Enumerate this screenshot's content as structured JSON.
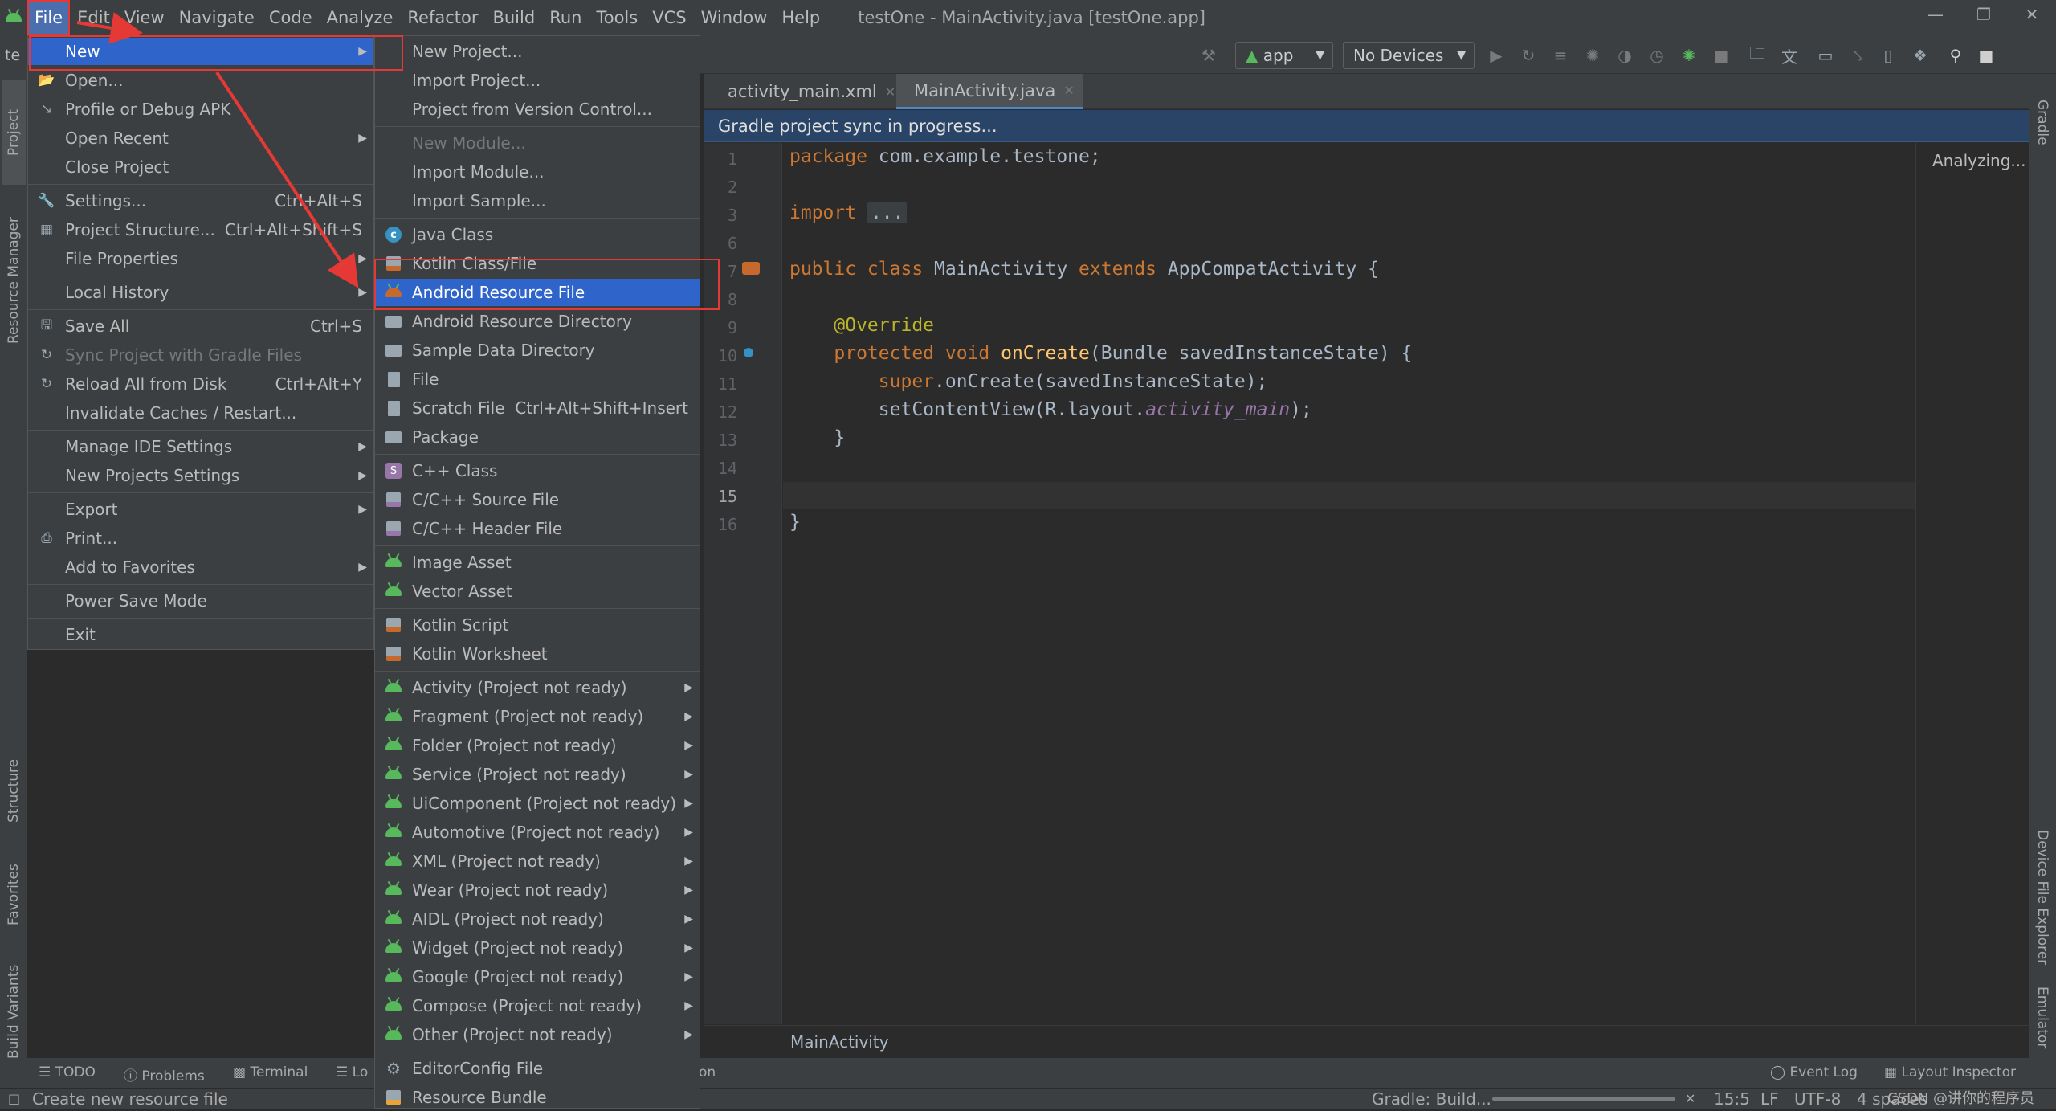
{
  "app": {
    "window_title": "testOne - MainActivity.java [testOne.app]",
    "project_stub": "te"
  },
  "menubar": [
    "File",
    "Edit",
    "View",
    "Navigate",
    "Code",
    "Analyze",
    "Refactor",
    "Build",
    "Run",
    "Tools",
    "VCS",
    "Window",
    "Help"
  ],
  "file_menu": [
    {
      "label": "New",
      "arrow": true,
      "selected": true
    },
    {
      "label": "Open..."
    },
    {
      "label": "Profile or Debug APK"
    },
    {
      "label": "Open Recent",
      "arrow": true
    },
    {
      "label": "Close Project"
    },
    {
      "label": "Settings...",
      "shortcut": "Ctrl+Alt+S"
    },
    {
      "label": "Project Structure...",
      "shortcut": "Ctrl+Alt+Shift+S"
    },
    {
      "label": "File Properties",
      "arrow": true
    },
    {
      "label": "Local History",
      "arrow": true
    },
    {
      "label": "Save All",
      "shortcut": "Ctrl+S"
    },
    {
      "label": "Sync Project with Gradle Files",
      "disabled": true
    },
    {
      "label": "Reload All from Disk",
      "shortcut": "Ctrl+Alt+Y"
    },
    {
      "label": "Invalidate Caches / Restart..."
    },
    {
      "label": "Manage IDE Settings",
      "arrow": true
    },
    {
      "label": "New Projects Settings",
      "arrow": true
    },
    {
      "label": "Export",
      "arrow": true
    },
    {
      "label": "Print..."
    },
    {
      "label": "Add to Favorites",
      "arrow": true
    },
    {
      "label": "Power Save Mode"
    },
    {
      "label": "Exit"
    }
  ],
  "new_menu": [
    {
      "label": "New Project..."
    },
    {
      "label": "Import Project..."
    },
    {
      "label": "Project from Version Control..."
    },
    {
      "label": "New Module...",
      "disabled": true
    },
    {
      "label": "Import Module..."
    },
    {
      "label": "Import Sample..."
    },
    {
      "label": "Java Class",
      "icon": "java-class-icon"
    },
    {
      "label": "Kotlin Class/File",
      "icon": "kotlin-file-icon"
    },
    {
      "label": "Android Resource File",
      "icon": "android-resource-file-icon",
      "selected": true
    },
    {
      "label": "Android Resource Directory",
      "icon": "folder-icon"
    },
    {
      "label": "Sample Data Directory",
      "icon": "folder-icon"
    },
    {
      "label": "File",
      "icon": "file-icon"
    },
    {
      "label": "Scratch File",
      "icon": "scratch-file-icon",
      "shortcut": "Ctrl+Alt+Shift+Insert"
    },
    {
      "label": "Package",
      "icon": "folder-icon"
    },
    {
      "label": "C++ Class",
      "icon": "cpp-class-icon"
    },
    {
      "label": "C/C++ Source File",
      "icon": "cpp-source-icon"
    },
    {
      "label": "C/C++ Header File",
      "icon": "cpp-header-icon"
    },
    {
      "label": "Image Asset",
      "icon": "android-icon"
    },
    {
      "label": "Vector Asset",
      "icon": "android-icon"
    },
    {
      "label": "Kotlin Script",
      "icon": "kotlin-script-icon"
    },
    {
      "label": "Kotlin Worksheet",
      "icon": "kotlin-worksheet-icon"
    },
    {
      "label": "Activity (Project not ready)",
      "icon": "android-icon",
      "arrow": true
    },
    {
      "label": "Fragment (Project not ready)",
      "icon": "android-icon",
      "arrow": true
    },
    {
      "label": "Folder (Project not ready)",
      "icon": "android-icon",
      "arrow": true
    },
    {
      "label": "Service (Project not ready)",
      "icon": "android-icon",
      "arrow": true
    },
    {
      "label": "UiComponent (Project not ready)",
      "icon": "android-icon",
      "arrow": true
    },
    {
      "label": "Automotive (Project not ready)",
      "icon": "android-icon",
      "arrow": true
    },
    {
      "label": "XML (Project not ready)",
      "icon": "android-icon",
      "arrow": true
    },
    {
      "label": "Wear (Project not ready)",
      "icon": "android-icon",
      "arrow": true
    },
    {
      "label": "AIDL (Project not ready)",
      "icon": "android-icon",
      "arrow": true
    },
    {
      "label": "Widget (Project not ready)",
      "icon": "android-icon",
      "arrow": true
    },
    {
      "label": "Google (Project not ready)",
      "icon": "android-icon",
      "arrow": true
    },
    {
      "label": "Compose (Project not ready)",
      "icon": "android-icon",
      "arrow": true
    },
    {
      "label": "Other (Project not ready)",
      "icon": "android-icon",
      "arrow": true
    },
    {
      "label": "EditorConfig File",
      "icon": "gear-icon"
    },
    {
      "label": "Resource Bundle",
      "icon": "resource-bundle-icon"
    }
  ],
  "toolbar": {
    "config": "app",
    "device": "No Devices"
  },
  "tabs": [
    "activity_main.xml",
    "MainActivity.java"
  ],
  "sync_banner": "Gradle project sync in progress...",
  "analyzing": "Analyzing...",
  "code_lines": [
    {
      "n": "1",
      "parts": [
        [
          "kw",
          "package "
        ],
        [
          "pl",
          "com.example.testone;"
        ]
      ]
    },
    {
      "n": "2",
      "parts": []
    },
    {
      "n": "3",
      "parts": [
        [
          "kw",
          "import "
        ],
        [
          "fold",
          "..."
        ]
      ]
    },
    {
      "n": "6",
      "parts": []
    },
    {
      "n": "7",
      "parts": [
        [
          "kw",
          "public class "
        ],
        [
          "pl",
          "MainActivity "
        ],
        [
          "kw",
          "extends "
        ],
        [
          "pl",
          "AppCompatActivity {"
        ]
      ]
    },
    {
      "n": "8",
      "parts": []
    },
    {
      "n": "9",
      "parts": [
        [
          "an",
          "    @Override"
        ]
      ]
    },
    {
      "n": "10",
      "parts": [
        [
          "kw",
          "    protected void "
        ],
        [
          "fn",
          "onCreate"
        ],
        [
          "pl",
          "(Bundle savedInstanceState) {"
        ]
      ]
    },
    {
      "n": "11",
      "parts": [
        [
          "kw",
          "        super"
        ],
        [
          "pl",
          ".onCreate(savedInstanceState);"
        ]
      ]
    },
    {
      "n": "12",
      "parts": [
        [
          "pl",
          "        setContentView(R.layout."
        ],
        [
          "it",
          "activity_main"
        ],
        [
          "pl",
          ");"
        ]
      ]
    },
    {
      "n": "13",
      "parts": [
        [
          "pl",
          "    }"
        ]
      ]
    },
    {
      "n": "14",
      "parts": []
    },
    {
      "n": "15",
      "parts": []
    },
    {
      "n": "16",
      "parts": [
        [
          "pl",
          "}"
        ]
      ]
    }
  ],
  "breadcrumb": "MainActivity",
  "left_tools": {
    "project": "Project",
    "resource_manager": "Resource Manager",
    "structure": "Structure",
    "favorites": "Favorites",
    "build_variants": "Build Variants"
  },
  "right_tools": {
    "gradle": "Gradle",
    "device_file_explorer": "Device File Explorer",
    "emulator": "Emulator"
  },
  "bottom_tools": {
    "todo": "TODO",
    "problems": "Problems",
    "terminal": "Terminal",
    "logcat": "Lo",
    "event_log": "Event Log",
    "layout_inspector": "Layout Inspector",
    "on": "on"
  },
  "status": {
    "message": "Create new resource file",
    "gradle": "Gradle: Build...",
    "position": "15:5",
    "line_sep": "LF",
    "encoding": "UTF-8",
    "indent": "4 spaces",
    "watermark": "CSDN @讲你的程序员"
  },
  "colors": {
    "selection": "#2f65ca",
    "annotation_red": "#e53935",
    "sync_banner": "#294466"
  }
}
